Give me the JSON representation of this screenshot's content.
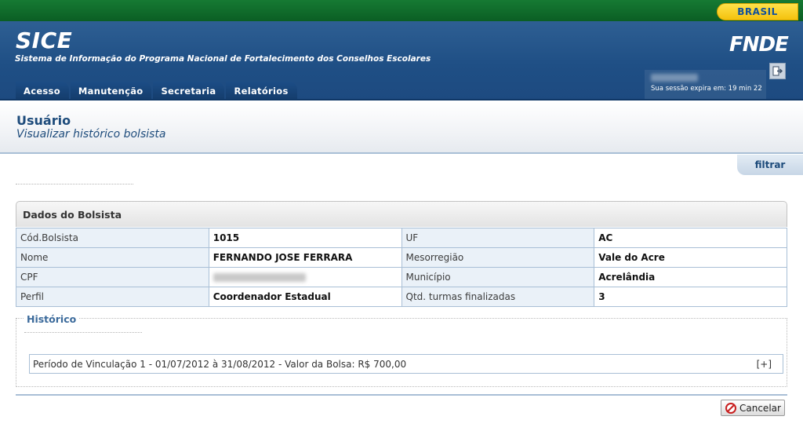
{
  "gov_bar": {
    "badge": "BRASIL"
  },
  "header": {
    "title": "SICE",
    "subtitle": "Sistema de Informação do Programa Nacional de Fortalecimento dos Conselhos Escolares",
    "logo": "FNDE",
    "session_text": "Sua sessão expira em: 19 min 22"
  },
  "nav": {
    "items": [
      "Acesso",
      "Manutenção",
      "Secretaria",
      "Relatórios"
    ]
  },
  "page": {
    "title": "Usuário",
    "subtitle": "Visualizar histórico bolsista",
    "filter_tab": "filtrar"
  },
  "dados": {
    "title": "Dados do Bolsista",
    "rows": [
      {
        "label1": "Cód.Bolsista",
        "value1": "1015",
        "label2": "UF",
        "value2": "AC"
      },
      {
        "label1": "Nome",
        "value1": "FERNANDO JOSE FERRARA",
        "label2": "Mesorregião",
        "value2": "Vale do Acre"
      },
      {
        "label1": "CPF",
        "value1": "",
        "label2": "Município",
        "value2": "Acrelândia"
      },
      {
        "label1": "Perfil",
        "value1": "Coordenador Estadual",
        "label2": "Qtd. turmas finalizadas",
        "value2": "3"
      }
    ]
  },
  "historico": {
    "title": "Histórico",
    "period_text": "Período de Vinculação 1 - 01/07/2012 à 31/08/2012 - Valor da Bolsa: R$ 700,00",
    "expand_label": "[+]"
  },
  "actions": {
    "cancel_label": "Cancelar"
  },
  "icons": {
    "logout": "logout-icon",
    "cancel": "cancel-icon"
  },
  "colors": {
    "gov_green": "#0c6e2c",
    "header_blue": "#1f4f85",
    "accent_blue": "#1d4b7b",
    "cancel_red": "#c81e1e"
  }
}
